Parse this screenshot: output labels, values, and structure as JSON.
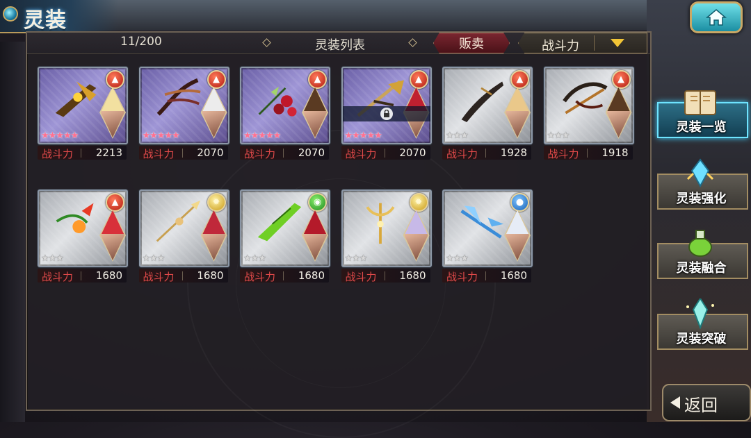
{
  "header": {
    "title": "灵装"
  },
  "list": {
    "count": "11/200",
    "title": "灵装列表",
    "sell_label": "贩卖",
    "sort_label": "战斗力"
  },
  "colors": {
    "accent": "#c9a866",
    "active": "#6ee4ff",
    "power_label": "#e24a4a"
  },
  "cards": [
    {
      "element": "fire",
      "rarity": "5",
      "locked": false,
      "power_label": "战斗力",
      "power": "2213"
    },
    {
      "element": "fire",
      "rarity": "5",
      "locked": false,
      "power_label": "战斗力",
      "power": "2070"
    },
    {
      "element": "fire",
      "rarity": "5",
      "locked": false,
      "power_label": "战斗力",
      "power": "2070"
    },
    {
      "element": "fire",
      "rarity": "5",
      "locked": true,
      "power_label": "战斗力",
      "power": "2070"
    },
    {
      "element": "fire",
      "rarity": "3",
      "locked": false,
      "power_label": "战斗力",
      "power": "1928"
    },
    {
      "element": "fire",
      "rarity": "3",
      "locked": false,
      "power_label": "战斗力",
      "power": "1918"
    },
    {
      "element": "fire",
      "rarity": "3",
      "locked": false,
      "power_label": "战斗力",
      "power": "1680"
    },
    {
      "element": "light",
      "rarity": "3",
      "locked": false,
      "power_label": "战斗力",
      "power": "1680"
    },
    {
      "element": "wind",
      "rarity": "3",
      "locked": false,
      "power_label": "战斗力",
      "power": "1680"
    },
    {
      "element": "light",
      "rarity": "3",
      "locked": false,
      "power_label": "战斗力",
      "power": "1680"
    },
    {
      "element": "water",
      "rarity": "3",
      "locked": false,
      "power_label": "战斗力",
      "power": "1680"
    }
  ],
  "side_menu": [
    {
      "label": "灵装一览",
      "icon": "book-icon",
      "active": true
    },
    {
      "label": "灵装强化",
      "icon": "crystal-enhance-icon",
      "active": false
    },
    {
      "label": "灵装融合",
      "icon": "potion-fusion-icon",
      "active": false
    },
    {
      "label": "灵装突破",
      "icon": "crystal-breakthrough-icon",
      "active": false
    }
  ],
  "back": {
    "label": "返回"
  }
}
